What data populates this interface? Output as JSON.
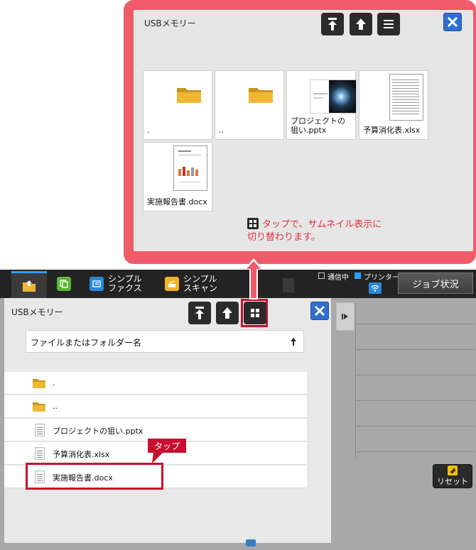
{
  "callout": {
    "title": "USBメモリー",
    "files": [
      {
        "label": ".",
        "kind": "folder"
      },
      {
        "label": "..",
        "kind": "folder"
      },
      {
        "label": "プロジェクトの\n狙い.pptx",
        "kind": "pptx"
      },
      {
        "label": "予算消化表.xlsx",
        "kind": "xlsx"
      },
      {
        "label": "実施報告書.docx",
        "kind": "docx"
      }
    ],
    "note_line1": "タップで、サムネイル表示に",
    "note_line2": "切り替わります。"
  },
  "topbar": {
    "tab_simple_fax": "シンプル\nファクス",
    "tab_simple_scan": "シンプル\nスキャン",
    "status_comm": "通信中",
    "status_printer": "プリンター",
    "job_status": "ジョブ状況"
  },
  "dialog": {
    "title": "USBメモリー",
    "sort_header": "ファイルまたはフォルダー名",
    "items": [
      {
        "label": ".",
        "kind": "folder"
      },
      {
        "label": "..",
        "kind": "folder"
      },
      {
        "label": "プロジェクトの狙い.pptx",
        "kind": "doc"
      },
      {
        "label": "予算消化表.xlsx",
        "kind": "doc"
      },
      {
        "label": "実施報告書.docx",
        "kind": "doc"
      }
    ],
    "tap_label": "タップ"
  },
  "reset_label": "リセット",
  "colors": {
    "callout_border": "#ef5b68",
    "highlight_red": "#c8102e",
    "close_blue": "#2f6fd0",
    "topbar_bg": "#232323"
  }
}
